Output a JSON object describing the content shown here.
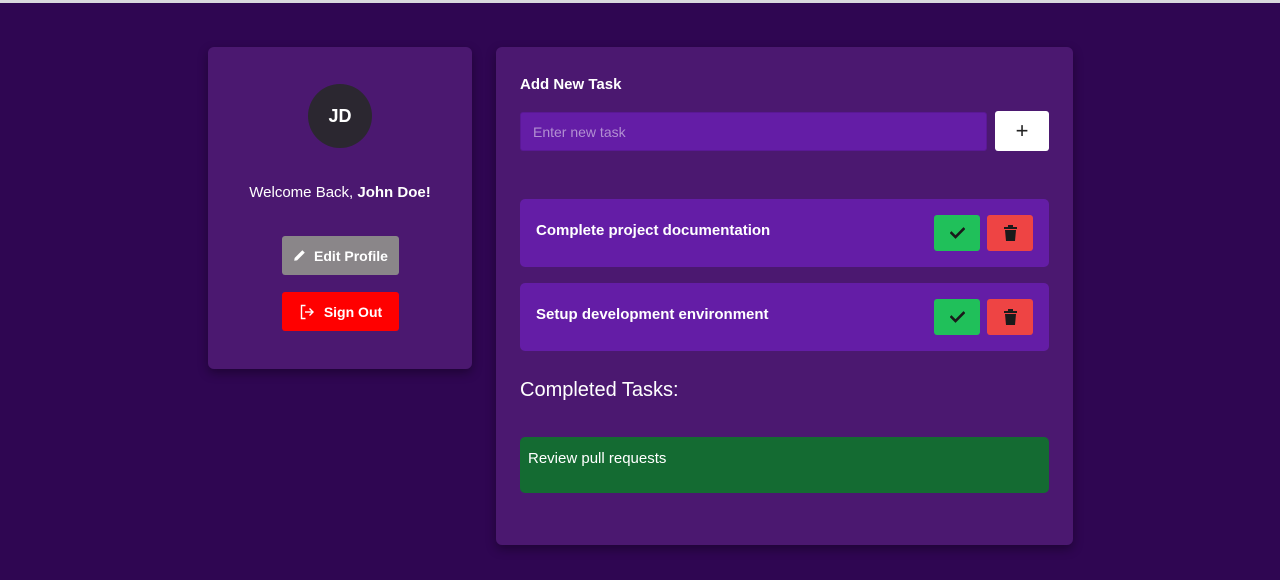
{
  "profile": {
    "avatar_initials": "JD",
    "welcome_prefix": "Welcome Back, ",
    "user_name": "John Doe!",
    "edit_label": "Edit Profile",
    "signout_label": "Sign Out"
  },
  "tasks": {
    "add_title": "Add New Task",
    "input_placeholder": "Enter new task",
    "input_value": "",
    "add_button_label": "+",
    "items": [
      {
        "text": "Complete project documentation",
        "complete_icon": "check-icon",
        "delete_icon": "trash-icon"
      },
      {
        "text": "Setup development environment",
        "complete_icon": "check-icon",
        "delete_icon": "trash-icon"
      }
    ],
    "completed_title": "Completed Tasks:",
    "completed": [
      {
        "text": "Review pull requests"
      }
    ]
  },
  "colors": {
    "background": "#2f0652",
    "card": "#4b1870",
    "task_row": "#641da6",
    "complete_green": "#20c05a",
    "delete_red": "#ee4444",
    "completed_row": "#146b32",
    "signout_red": "#ff0000",
    "edit_gray": "#8a8689"
  }
}
